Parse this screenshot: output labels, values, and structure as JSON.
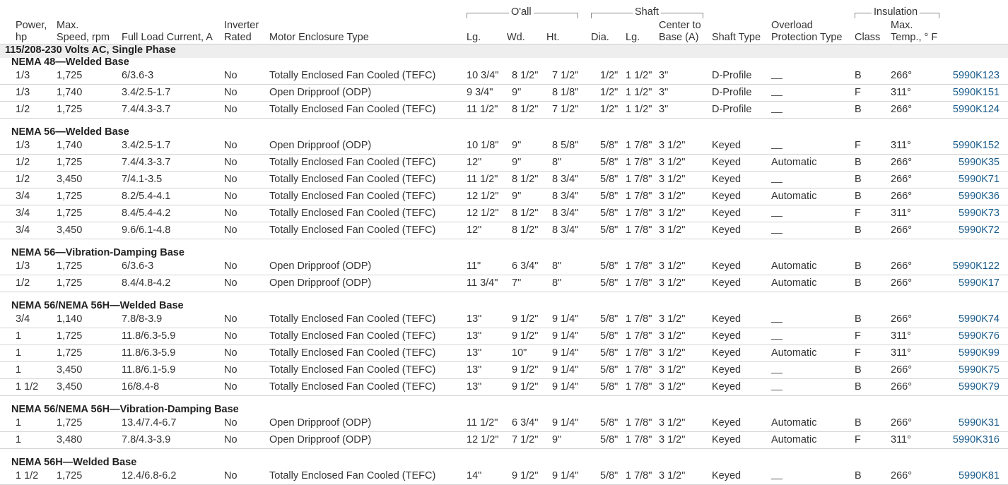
{
  "header": {
    "groups": {
      "overall": "O'all",
      "shaft": "Shaft",
      "insulation": "Insulation"
    },
    "columns": {
      "power": [
        "Power,",
        "hp"
      ],
      "speed": [
        "Max.",
        "Speed, rpm"
      ],
      "current": "Full Load Current, A",
      "inverter": [
        "Inverter",
        "Rated"
      ],
      "enclosure": "Motor Enclosure Type",
      "lg": "Lg.",
      "wd": "Wd.",
      "ht": "Ht.",
      "dia": "Dia.",
      "shaft_lg": "Lg.",
      "center": [
        "Center to",
        "Base (A)"
      ],
      "shaft_type": "Shaft Type",
      "overload": [
        "Overload",
        "Protection Type"
      ],
      "class": "Class",
      "temp": [
        "Max.",
        "Temp., ° F"
      ]
    }
  },
  "voltage": "115/208-230 Volts AC, Single Phase",
  "sections": [
    {
      "title": "NEMA 48—Welded Base",
      "rows": [
        {
          "hp": "1/3",
          "rpm": "1,725",
          "current": "6/3.6-3",
          "inverter": "No",
          "enclosure": "Totally Enclosed Fan Cooled (TEFC)",
          "lg": "10 3/4\"",
          "wd": "8 1/2\"",
          "ht": "7 1/2\"",
          "dia": "1/2\"",
          "slg": "1 1/2\"",
          "center": "3\"",
          "shaft": "D-Profile",
          "overload": "",
          "cls": "B",
          "temp": "266°",
          "part": "5990K123"
        },
        {
          "hp": "1/3",
          "rpm": "1,740",
          "current": "3.4/2.5-1.7",
          "inverter": "No",
          "enclosure": "Open Dripproof (ODP)",
          "lg": "9 3/4\"",
          "wd": "9\"",
          "ht": "8 1/8\"",
          "dia": "1/2\"",
          "slg": "1 1/2\"",
          "center": "3\"",
          "shaft": "D-Profile",
          "overload": "",
          "cls": "F",
          "temp": "311°",
          "part": "5990K151"
        },
        {
          "hp": "1/2",
          "rpm": "1,725",
          "current": "7.4/4.3-3.7",
          "inverter": "No",
          "enclosure": "Totally Enclosed Fan Cooled (TEFC)",
          "lg": "11 1/2\"",
          "wd": "8 1/2\"",
          "ht": "7 1/2\"",
          "dia": "1/2\"",
          "slg": "1 1/2\"",
          "center": "3\"",
          "shaft": "D-Profile",
          "overload": "",
          "cls": "B",
          "temp": "266°",
          "part": "5990K124"
        }
      ]
    },
    {
      "title": "NEMA 56—Welded Base",
      "rows": [
        {
          "hp": "1/3",
          "rpm": "1,740",
          "current": "3.4/2.5-1.7",
          "inverter": "No",
          "enclosure": "Open Dripproof (ODP)",
          "lg": "10 1/8\"",
          "wd": "9\"",
          "ht": "8 5/8\"",
          "dia": "5/8\"",
          "slg": "1 7/8\"",
          "center": "3 1/2\"",
          "shaft": "Keyed",
          "overload": "",
          "cls": "F",
          "temp": "311°",
          "part": "5990K152"
        },
        {
          "hp": "1/2",
          "rpm": "1,725",
          "current": "7.4/4.3-3.7",
          "inverter": "No",
          "enclosure": "Totally Enclosed Fan Cooled (TEFC)",
          "lg": "12\"",
          "wd": "9\"",
          "ht": "8\"",
          "dia": "5/8\"",
          "slg": "1 7/8\"",
          "center": "3 1/2\"",
          "shaft": "Keyed",
          "overload": "Automatic",
          "cls": "B",
          "temp": "266°",
          "part": "5990K35"
        },
        {
          "hp": "1/2",
          "rpm": "3,450",
          "current": "7/4.1-3.5",
          "inverter": "No",
          "enclosure": "Totally Enclosed Fan Cooled (TEFC)",
          "lg": "11 1/2\"",
          "wd": "8 1/2\"",
          "ht": "8 3/4\"",
          "dia": "5/8\"",
          "slg": "1 7/8\"",
          "center": "3 1/2\"",
          "shaft": "Keyed",
          "overload": "",
          "cls": "B",
          "temp": "266°",
          "part": "5990K71"
        },
        {
          "hp": "3/4",
          "rpm": "1,725",
          "current": "8.2/5.4-4.1",
          "inverter": "No",
          "enclosure": "Totally Enclosed Fan Cooled (TEFC)",
          "lg": "12 1/2\"",
          "wd": "9\"",
          "ht": "8 3/4\"",
          "dia": "5/8\"",
          "slg": "1 7/8\"",
          "center": "3 1/2\"",
          "shaft": "Keyed",
          "overload": "Automatic",
          "cls": "B",
          "temp": "266°",
          "part": "5990K36"
        },
        {
          "hp": "3/4",
          "rpm": "1,725",
          "current": "8.4/5.4-4.2",
          "inverter": "No",
          "enclosure": "Totally Enclosed Fan Cooled (TEFC)",
          "lg": "12 1/2\"",
          "wd": "8 1/2\"",
          "ht": "8 3/4\"",
          "dia": "5/8\"",
          "slg": "1 7/8\"",
          "center": "3 1/2\"",
          "shaft": "Keyed",
          "overload": "",
          "cls": "F",
          "temp": "311°",
          "part": "5990K73"
        },
        {
          "hp": "3/4",
          "rpm": "3,450",
          "current": "9.6/6.1-4.8",
          "inverter": "No",
          "enclosure": "Totally Enclosed Fan Cooled (TEFC)",
          "lg": "12\"",
          "wd": "8 1/2\"",
          "ht": "8 3/4\"",
          "dia": "5/8\"",
          "slg": "1 7/8\"",
          "center": "3 1/2\"",
          "shaft": "Keyed",
          "overload": "",
          "cls": "B",
          "temp": "266°",
          "part": "5990K72"
        }
      ]
    },
    {
      "title": "NEMA 56—Vibration-Damping Base",
      "rows": [
        {
          "hp": "1/3",
          "rpm": "1,725",
          "current": "6/3.6-3",
          "inverter": "No",
          "enclosure": "Open Dripproof (ODP)",
          "lg": "11\"",
          "wd": "6 3/4\"",
          "ht": "8\"",
          "dia": "5/8\"",
          "slg": "1 7/8\"",
          "center": "3 1/2\"",
          "shaft": "Keyed",
          "overload": "Automatic",
          "cls": "B",
          "temp": "266°",
          "part": "5990K122"
        },
        {
          "hp": "1/2",
          "rpm": "1,725",
          "current": "8.4/4.8-4.2",
          "inverter": "No",
          "enclosure": "Open Dripproof (ODP)",
          "lg": "11 3/4\"",
          "wd": "7\"",
          "ht": "8\"",
          "dia": "5/8\"",
          "slg": "1 7/8\"",
          "center": "3 1/2\"",
          "shaft": "Keyed",
          "overload": "Automatic",
          "cls": "B",
          "temp": "266°",
          "part": "5990K17"
        }
      ]
    },
    {
      "title": "NEMA 56/NEMA 56H—Welded Base",
      "rows": [
        {
          "hp": "3/4",
          "rpm": "1,140",
          "current": "7.8/8-3.9",
          "inverter": "No",
          "enclosure": "Totally Enclosed Fan Cooled (TEFC)",
          "lg": "13\"",
          "wd": "9 1/2\"",
          "ht": "9 1/4\"",
          "dia": "5/8\"",
          "slg": "1 7/8\"",
          "center": "3 1/2\"",
          "shaft": "Keyed",
          "overload": "",
          "cls": "B",
          "temp": "266°",
          "part": "5990K74"
        },
        {
          "hp": "1",
          "rpm": "1,725",
          "current": "11.8/6.3-5.9",
          "inverter": "No",
          "enclosure": "Totally Enclosed Fan Cooled (TEFC)",
          "lg": "13\"",
          "wd": "9 1/2\"",
          "ht": "9 1/4\"",
          "dia": "5/8\"",
          "slg": "1 7/8\"",
          "center": "3 1/2\"",
          "shaft": "Keyed",
          "overload": "",
          "cls": "F",
          "temp": "311°",
          "part": "5990K76"
        },
        {
          "hp": "1",
          "rpm": "1,725",
          "current": "11.8/6.3-5.9",
          "inverter": "No",
          "enclosure": "Totally Enclosed Fan Cooled (TEFC)",
          "lg": "13\"",
          "wd": "10\"",
          "ht": "9 1/4\"",
          "dia": "5/8\"",
          "slg": "1 7/8\"",
          "center": "3 1/2\"",
          "shaft": "Keyed",
          "overload": "Automatic",
          "cls": "F",
          "temp": "311°",
          "part": "5990K99"
        },
        {
          "hp": "1",
          "rpm": "3,450",
          "current": "11.8/6.1-5.9",
          "inverter": "No",
          "enclosure": "Totally Enclosed Fan Cooled (TEFC)",
          "lg": "13\"",
          "wd": "9 1/2\"",
          "ht": "9 1/4\"",
          "dia": "5/8\"",
          "slg": "1 7/8\"",
          "center": "3 1/2\"",
          "shaft": "Keyed",
          "overload": "",
          "cls": "B",
          "temp": "266°",
          "part": "5990K75"
        },
        {
          "hp": "1 1/2",
          "rpm": "3,450",
          "current": "16/8.4-8",
          "inverter": "No",
          "enclosure": "Totally Enclosed Fan Cooled (TEFC)",
          "lg": "13\"",
          "wd": "9 1/2\"",
          "ht": "9 1/4\"",
          "dia": "5/8\"",
          "slg": "1 7/8\"",
          "center": "3 1/2\"",
          "shaft": "Keyed",
          "overload": "",
          "cls": "B",
          "temp": "266°",
          "part": "5990K79"
        }
      ]
    },
    {
      "title": "NEMA 56/NEMA 56H—Vibration-Damping Base",
      "rows": [
        {
          "hp": "1",
          "rpm": "1,725",
          "current": "13.4/7.4-6.7",
          "inverter": "No",
          "enclosure": "Open Dripproof (ODP)",
          "lg": "11 1/2\"",
          "wd": "6 3/4\"",
          "ht": "9 1/4\"",
          "dia": "5/8\"",
          "slg": "1 7/8\"",
          "center": "3 1/2\"",
          "shaft": "Keyed",
          "overload": "Automatic",
          "cls": "B",
          "temp": "266°",
          "part": "5990K31"
        },
        {
          "hp": "1",
          "rpm": "3,480",
          "current": "7.8/4.3-3.9",
          "inverter": "No",
          "enclosure": "Open Dripproof (ODP)",
          "lg": "12 1/2\"",
          "wd": "7 1/2\"",
          "ht": "9\"",
          "dia": "5/8\"",
          "slg": "1 7/8\"",
          "center": "3 1/2\"",
          "shaft": "Keyed",
          "overload": "Automatic",
          "cls": "F",
          "temp": "311°",
          "part": "5990K316"
        }
      ]
    },
    {
      "title": "NEMA 56H—Welded Base",
      "rows": [
        {
          "hp": "1 1/2",
          "rpm": "1,725",
          "current": "12.4/6.8-6.2",
          "inverter": "No",
          "enclosure": "Totally Enclosed Fan Cooled (TEFC)",
          "lg": "14\"",
          "wd": "9 1/2\"",
          "ht": "9 1/4\"",
          "dia": "5/8\"",
          "slg": "1 7/8\"",
          "center": "3 1/2\"",
          "shaft": "Keyed",
          "overload": "",
          "cls": "B",
          "temp": "266°",
          "part": "5990K81"
        }
      ]
    }
  ]
}
